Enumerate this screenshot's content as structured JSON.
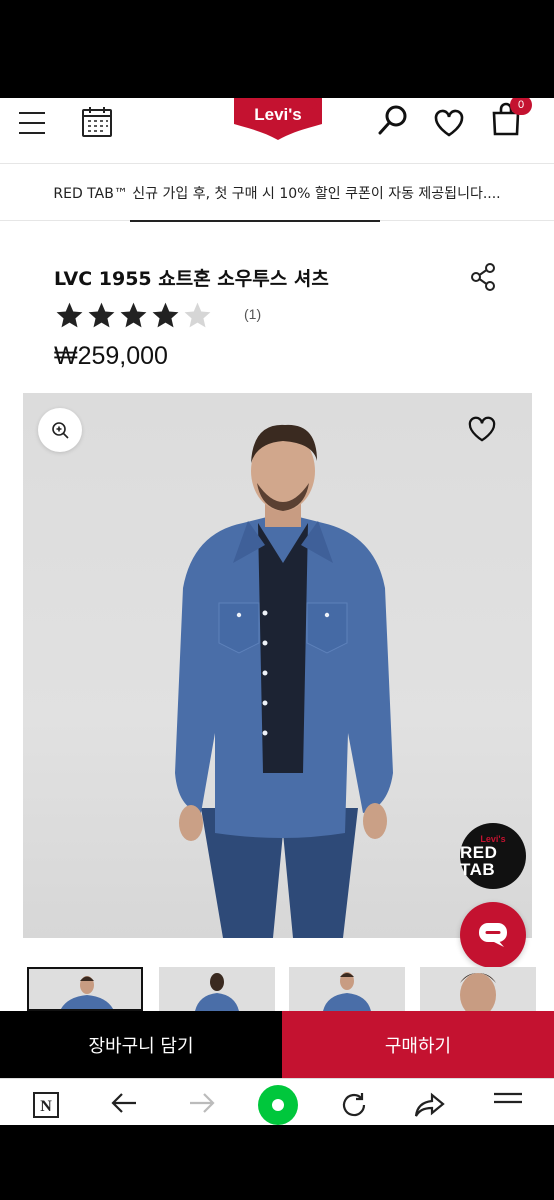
{
  "header": {
    "logo_text": "Levi's",
    "cart_count": "0",
    "icons": [
      "menu-icon",
      "calendar-icon",
      "search-icon",
      "heart-icon",
      "bag-icon"
    ]
  },
  "promo": {
    "text": "RED TAB™ 신규 가입 후, 첫 구매 시 10% 할인 쿠폰이 자동 제공됩니다...."
  },
  "product": {
    "title": "LVC 1955 쇼트혼 소우투스 셔츠",
    "rating": 4,
    "rating_max": 5,
    "review_count": "(1)",
    "price": "₩259,000"
  },
  "hero": {
    "badge": {
      "line1": "Levi's",
      "line2": "RED TAB"
    },
    "icons": [
      "zoom-icon",
      "wishlist-heart-icon",
      "chat-icon"
    ]
  },
  "thumbnails": {
    "count": 4,
    "selected": 0
  },
  "cta": {
    "cart_label": "장바구니 담기",
    "buy_label": "구매하기"
  },
  "toolbar": {
    "icons": [
      "notion-icon",
      "back-icon",
      "forward-icon",
      "home-icon",
      "refresh-icon",
      "share-icon",
      "menu-icon"
    ]
  },
  "colors": {
    "brand_red": "#c41230",
    "text": "#111111",
    "denim": "#4a6ea8",
    "home_green": "#00c73c"
  }
}
